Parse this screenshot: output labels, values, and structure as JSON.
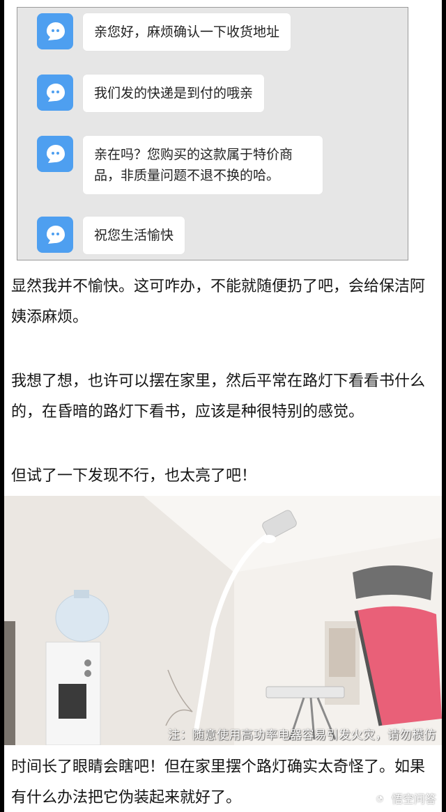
{
  "chat": {
    "messages": [
      {
        "text": "亲您好，麻烦确认一下收货地址"
      },
      {
        "text": "我们发的快递是到付的哦亲"
      },
      {
        "text": "亲在吗？您购买的这款属于特价商品，非质量问题不退不换的哈。"
      },
      {
        "text": "祝您生活愉快"
      }
    ]
  },
  "paragraphs": [
    "显然我并不愉快。这可咋办，不能就随便扔了吧，会给保洁阿姨添麻烦。",
    "我想了想，也许可以摆在家里，然后平常在路灯下看看书什么的，在昏暗的路灯下看书，应该是种很特别的感觉。",
    "但试了一下发现不行，也太亮了吧！",
    "时间长了眼睛会瞎吧！但在家里摆个路灯确实太奇怪了。如果有什么办法把它伪装起来就好了。"
  ],
  "photo": {
    "caption": "注：随意使用高功率电器容易引发火灾，请勿模仿",
    "icons": [
      "street-lamp",
      "water-dispenser",
      "office-chair",
      "telescope"
    ]
  },
  "watermark": {
    "text": "悟空问答"
  },
  "colors": {
    "avatar": "#4e9ff0",
    "panel": "#e6e6e6",
    "bubble": "#ffffff"
  }
}
